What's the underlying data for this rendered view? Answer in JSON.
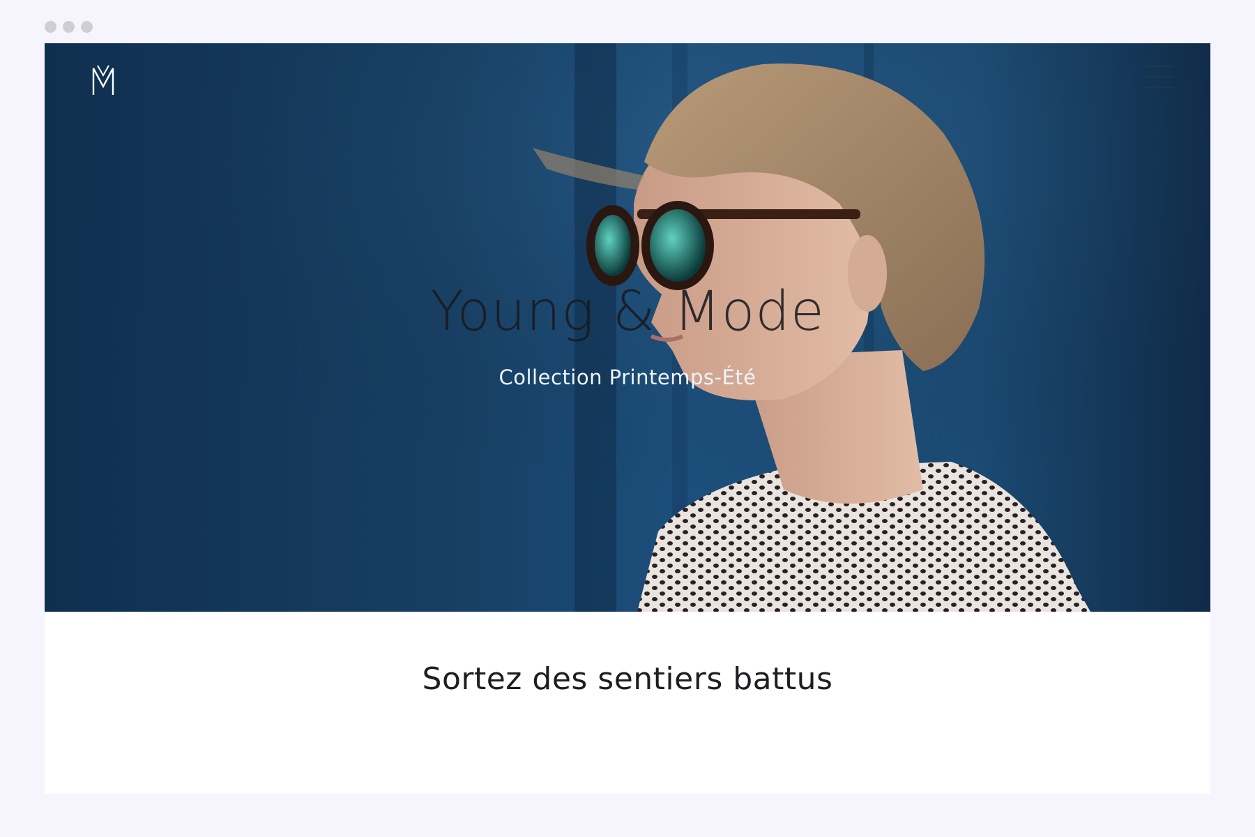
{
  "hero": {
    "title": "Young & Mode",
    "subtitle": "Collection Printemps-Été"
  },
  "section": {
    "heading": "Sortez des sentiers battus"
  },
  "icons": {
    "logo": "monogram-m-logo",
    "menu": "hamburger-menu-icon"
  },
  "colors": {
    "page_background": "#f6f5fd",
    "hero_blue": "#1c4f7c",
    "heading_text": "#1d1d22"
  }
}
